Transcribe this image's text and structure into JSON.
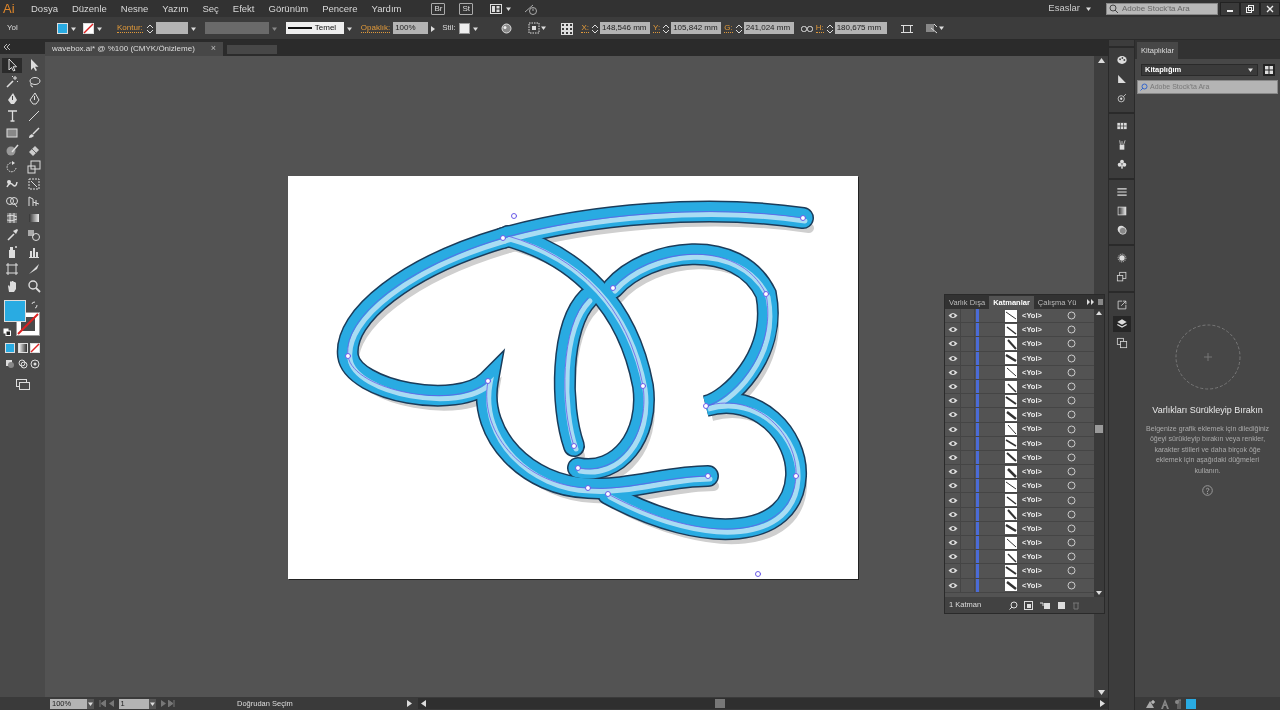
{
  "app": {
    "logo": "Ai"
  },
  "menu": [
    "Dosya",
    "Düzenle",
    "Nesne",
    "Yazım",
    "Seç",
    "Efekt",
    "Görünüm",
    "Pencere",
    "Yardım"
  ],
  "bridge_buttons": [
    "Br",
    "St"
  ],
  "workspace": "Esaslar",
  "stock_search": {
    "placeholder": "Adobe Stock'ta Ara"
  },
  "control_bar": {
    "selection": "Yol",
    "stroke_label": "Kontur:",
    "stroke_style": "Temel",
    "opacity_label": "Opaklık:",
    "opacity": "100%",
    "style_label": "Stil:",
    "transform": [
      {
        "label": "X:",
        "value": "148,546 mm"
      },
      {
        "label": "Y:",
        "value": "105,842 mm"
      },
      {
        "label": "G:",
        "value": "241,024 mm"
      },
      {
        "label": "H:",
        "value": "180,675 mm"
      }
    ]
  },
  "document_tab": {
    "title": "wavebox.ai* @ %100 (CMYK/Önizleme)",
    "close": "×"
  },
  "tools": [
    {
      "selected": true
    },
    {
      "selected": false
    },
    {
      "selected": false
    },
    {
      "selected": false
    },
    {
      "selected": false
    },
    {
      "selected": false
    },
    {
      "selected": false
    },
    {
      "selected": false
    },
    {
      "selected": false
    },
    {
      "selected": false
    },
    {
      "selected": false
    },
    {
      "selected": false
    },
    {
      "selected": false
    },
    {
      "selected": false
    },
    {
      "selected": false
    },
    {
      "selected": false
    },
    {
      "selected": false
    },
    {
      "selected": false
    },
    {
      "selected": false
    },
    {
      "selected": false
    },
    {
      "selected": false
    },
    {
      "selected": false
    },
    {
      "selected": false
    },
    {
      "selected": false
    },
    {
      "selected": false
    },
    {
      "selected": false
    },
    {
      "selected": false
    },
    {
      "selected": false
    }
  ],
  "layers_panel": {
    "tabs": [
      {
        "label": "Varlık Dışa",
        "selected": false
      },
      {
        "label": "Katmanlar",
        "selected": true
      },
      {
        "label": "Çalışma Yü",
        "selected": false
      }
    ],
    "rows": [
      {
        "name": "<Yol>",
        "visible": true
      },
      {
        "name": "<Yol>",
        "visible": true
      },
      {
        "name": "<Yol>",
        "visible": true
      },
      {
        "name": "<Yol>",
        "visible": true
      },
      {
        "name": "<Yol>",
        "visible": true
      },
      {
        "name": "<Yol>",
        "visible": true
      },
      {
        "name": "<Yol>",
        "visible": true
      },
      {
        "name": "<Yol>",
        "visible": true
      },
      {
        "name": "<Yol>",
        "visible": true
      },
      {
        "name": "<Yol>",
        "visible": true
      },
      {
        "name": "<Yol>",
        "visible": true
      },
      {
        "name": "<Yol>",
        "visible": true
      },
      {
        "name": "<Yol>",
        "visible": true
      },
      {
        "name": "<Yol>",
        "visible": true
      },
      {
        "name": "<Yol>",
        "visible": true
      },
      {
        "name": "<Yol>",
        "visible": true
      },
      {
        "name": "<Yol>",
        "visible": true
      },
      {
        "name": "<Yol>",
        "visible": true
      },
      {
        "name": "<Yol>",
        "visible": true
      },
      {
        "name": "<Yol>",
        "visible": true
      }
    ],
    "footer": "1 Katman"
  },
  "dock": [
    {
      "selected": false
    },
    {
      "selected": false
    },
    {
      "selected": false
    },
    {
      "selected": false
    },
    {
      "selected": false
    },
    {
      "selected": false
    },
    {
      "selected": false
    },
    {
      "selected": false
    },
    {
      "selected": false
    },
    {
      "selected": false
    },
    {
      "selected": false
    },
    {
      "selected": false
    },
    {
      "selected": true
    },
    {
      "selected": false
    }
  ],
  "libraries_panel": {
    "tab": "Kitaplıklar",
    "library": "Kitaplığım",
    "search_placeholder": "Adobe Stock'ta Ara",
    "empty_title": "Varlıkları Sürükleyip Bırakın",
    "empty_text": "Belgenize grafik eklemek için dilediğiniz öğeyi sürükleyip bırakın veya renkler, karakter stilleri ve daha birçok öğe eklemek için aşağıdaki düğmeleri kullanın."
  },
  "status_bar": {
    "zoom": "100%",
    "artboard": "1",
    "tool": "Doğrudan Seçim"
  }
}
